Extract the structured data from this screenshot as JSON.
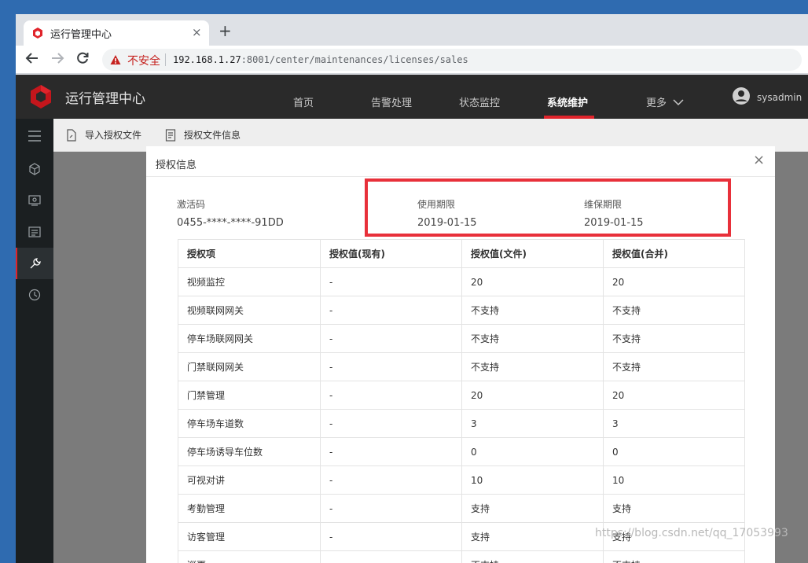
{
  "browser": {
    "tab_title": "运行管理中心",
    "close_tab": "×",
    "new_tab": "+",
    "insecure_label": "不安全",
    "url_host": "192.168.1.27",
    "url_rest": ":8001/center/maintenances/licenses/sales"
  },
  "app": {
    "title": "运行管理中心",
    "nav": [
      {
        "label": "首页"
      },
      {
        "label": "告警处理"
      },
      {
        "label": "状态监控"
      },
      {
        "label": "系统维护",
        "active": true
      },
      {
        "label": "更多"
      }
    ],
    "user": "sysadmin",
    "accent_color": "#e0242b"
  },
  "sidebar": {
    "icons": [
      "menu-icon",
      "cube-icon",
      "monitor-icon",
      "list-icon",
      "wrench-icon",
      "clock-icon"
    ],
    "active": "wrench-icon"
  },
  "subbar": {
    "import_label": "导入授权文件",
    "info_label": "授权文件信息"
  },
  "dialog": {
    "title": "授权信息",
    "close": "×",
    "activation_label": "激活码",
    "activation_value": "0455-****-****-91DD",
    "usage_label": "使用期限",
    "usage_value": "2019-01-15",
    "maintenance_label": "维保期限",
    "maintenance_value": "2019-01-15",
    "table": {
      "headers": [
        "授权项",
        "授权值(现有)",
        "授权值(文件)",
        "授权值(合并)"
      ],
      "rows": [
        [
          "视频监控",
          "-",
          "20",
          "20"
        ],
        [
          "视频联网网关",
          "-",
          "不支持",
          "不支持"
        ],
        [
          "停车场联网网关",
          "-",
          "不支持",
          "不支持"
        ],
        [
          "门禁联网网关",
          "-",
          "不支持",
          "不支持"
        ],
        [
          "门禁管理",
          "-",
          "20",
          "20"
        ],
        [
          "停车场车道数",
          "-",
          "3",
          "3"
        ],
        [
          "停车场诱导车位数",
          "-",
          "0",
          "0"
        ],
        [
          "可视对讲",
          "-",
          "10",
          "10"
        ],
        [
          "考勤管理",
          "-",
          "支持",
          "支持"
        ],
        [
          "访客管理",
          "-",
          "支持",
          "支持"
        ],
        [
          "巡更",
          "-",
          "不支持",
          "不支持"
        ]
      ]
    }
  },
  "watermark": "https://blog.csdn.net/qq_17053993"
}
